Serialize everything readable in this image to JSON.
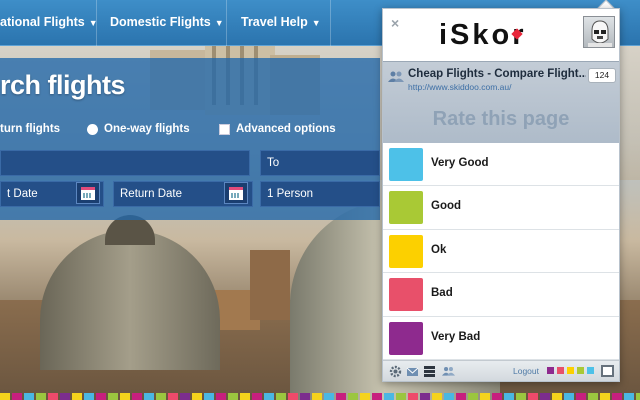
{
  "website": {
    "nav": [
      {
        "label": "ational Flights"
      },
      {
        "label": "Domestic Flights"
      },
      {
        "label": "Travel Help"
      }
    ],
    "nav_caret": "▼",
    "search_title": "rch flights",
    "trip_options": {
      "return": "turn flights",
      "one_way": "One-way flights",
      "advanced": "Advanced options"
    },
    "fields": {
      "to": "To",
      "depart_date": "t Date",
      "return_date": "Return Date",
      "passengers": "1 Person"
    },
    "strip_colors": [
      "#f5d31c",
      "#c71f7e",
      "#4ab7e3",
      "#9bc63f",
      "#ee4a6a",
      "#7c2d8e",
      "#f5d31c",
      "#4ab7e3",
      "#c71f7e",
      "#9bc63f"
    ]
  },
  "popup": {
    "close_label": "×",
    "logo_text": "iSkor",
    "site": {
      "title": "Cheap Flights - Compare Flight...",
      "url": "http://www.skiddoo.com.au/",
      "count": "124"
    },
    "rate_heading": "Rate this page",
    "ratings": [
      {
        "label": "Very Good",
        "color": "#4dc1e8"
      },
      {
        "label": "Good",
        "color": "#a9c935"
      },
      {
        "label": "Ok",
        "color": "#fcd000"
      },
      {
        "label": "Bad",
        "color": "#e8506a"
      },
      {
        "label": "Very Bad",
        "color": "#8e2a8e"
      }
    ],
    "footer": {
      "icons": [
        "gear-icon",
        "mail-icon",
        "list-icon",
        "people-icon"
      ],
      "logout_label": "Logout",
      "mini_swatches": [
        "#8e2a8e",
        "#e8506a",
        "#fcd000",
        "#a9c935",
        "#4dc1e8"
      ]
    }
  }
}
